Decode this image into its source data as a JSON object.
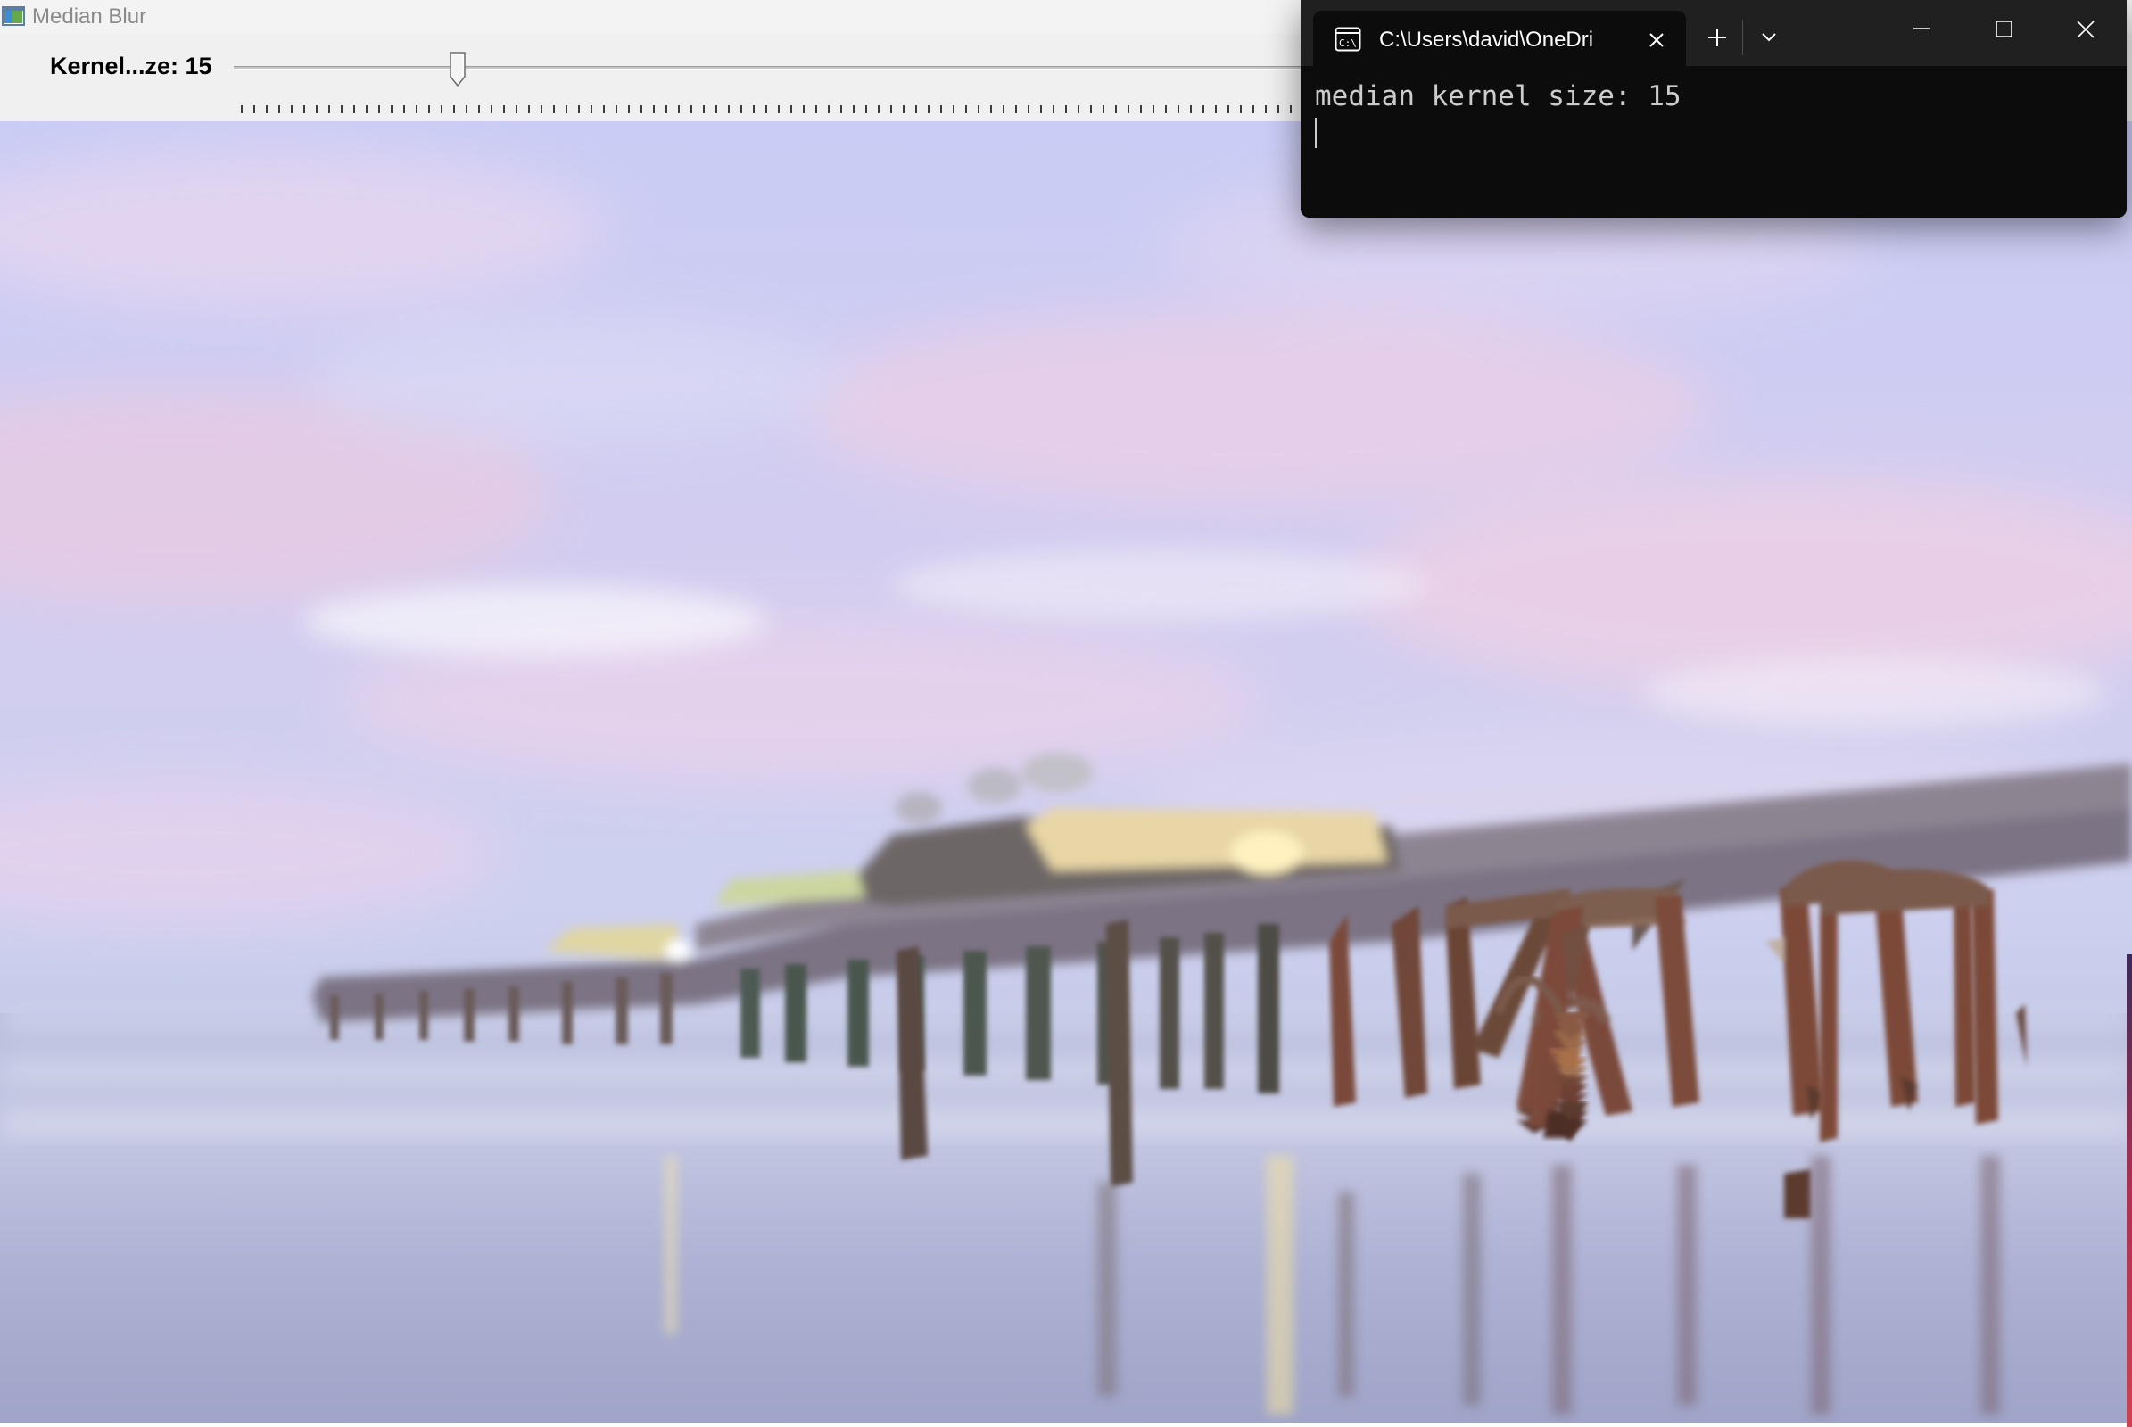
{
  "cv_window": {
    "title": "Median Blur",
    "trackbar": {
      "label": "Kernel...ze: 15",
      "value": 15
    },
    "image_alt": "Median-blurred photo of a fishing pier over the beach at dusk"
  },
  "terminal": {
    "tab_title": "C:\\Users\\david\\OneDri",
    "output_line": "median kernel size: 15"
  },
  "icons": {
    "app": "opencv-window-icon",
    "terminal_tab": "cmd-icon",
    "tab_close": "close-icon",
    "new_tab": "plus-icon",
    "dropdown": "chevron-down-icon",
    "minimize": "minimize-icon",
    "maximize": "maximize-icon",
    "close": "close-icon"
  },
  "colors": {
    "terminal_bg": "#0c0c0c",
    "terminal_tabbar": "#202020",
    "terminal_text": "#cccccc",
    "cv_chrome": "#f0f0f0"
  }
}
